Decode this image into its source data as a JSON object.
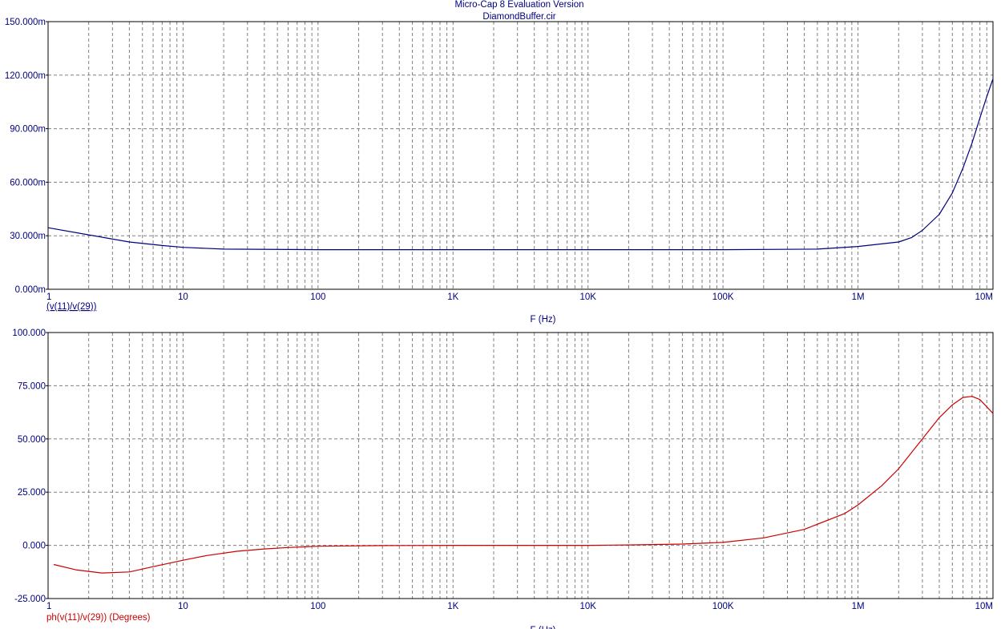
{
  "window": {
    "title": "Micro-Cap 8 Evaluation Version",
    "filename": "DiamondBuffer.cir"
  },
  "colors": {
    "text": "#000080",
    "grid": "#808080",
    "frame": "#000000",
    "magnitude_trace": "#000080",
    "phase_trace": "#cc0000",
    "background": "#ffffff"
  },
  "chart_data": [
    {
      "type": "line",
      "x_scale": "log",
      "xlim": [
        1,
        10000000
      ],
      "x_ticks": [
        1,
        10,
        100,
        1000,
        10000,
        100000,
        1000000,
        10000000
      ],
      "x_tick_labels": [
        "1",
        "10",
        "100",
        "1K",
        "10K",
        "100K",
        "1M",
        "10M"
      ],
      "xlabel": "F (Hz)",
      "ylim": [
        0,
        0.15
      ],
      "y_ticks": [
        0,
        0.03,
        0.06,
        0.09,
        0.12,
        0.15
      ],
      "y_tick_labels": [
        "0.000m",
        "30.000m",
        "60.000m",
        "90.000m",
        "120.000m",
        "150.000m"
      ],
      "grid": true,
      "legend_position": "bottom-left",
      "series": [
        {
          "name": "(v(11)/v(29))",
          "color": "#000080",
          "x": [
            1,
            2,
            4,
            7,
            10,
            20,
            100,
            1000,
            10000,
            100000,
            500000,
            1000000,
            2000000,
            2500000,
            3000000,
            4000000,
            5000000,
            6000000,
            7000000,
            8000000,
            9000000,
            10000000
          ],
          "y": [
            0.0345,
            0.0305,
            0.0265,
            0.0245,
            0.0235,
            0.0225,
            0.0222,
            0.0222,
            0.0222,
            0.0222,
            0.0225,
            0.024,
            0.0265,
            0.029,
            0.033,
            0.042,
            0.054,
            0.068,
            0.082,
            0.096,
            0.108,
            0.118
          ]
        }
      ]
    },
    {
      "type": "line",
      "x_scale": "log",
      "xlim": [
        1,
        10000000
      ],
      "x_ticks": [
        1,
        10,
        100,
        1000,
        10000,
        100000,
        1000000,
        10000000
      ],
      "x_tick_labels": [
        "1",
        "10",
        "100",
        "1K",
        "10K",
        "100K",
        "1M",
        "10M"
      ],
      "xlabel": "F (Hz)",
      "ylim": [
        -25,
        100
      ],
      "y_ticks": [
        -25,
        0,
        25,
        50,
        75,
        100
      ],
      "y_tick_labels": [
        "-25.000",
        "0.000",
        "25.000",
        "50.000",
        "75.000",
        "100.000"
      ],
      "grid": true,
      "legend_position": "bottom-left",
      "series": [
        {
          "name": "ph(v(11)/v(29)) (Degrees)",
          "color": "#cc0000",
          "x": [
            1.1,
            1.6,
            2.5,
            4,
            6,
            10,
            15,
            25,
            40,
            60,
            100,
            300,
            1000,
            10000,
            20000,
            50000,
            100000,
            200000,
            400000,
            800000,
            1000000,
            1500000,
            2000000,
            3000000,
            4000000,
            5000000,
            6000000,
            7000000,
            8000000,
            10000000
          ],
          "y": [
            -9,
            -11.5,
            -13,
            -12.5,
            -10,
            -7,
            -4.8,
            -2.8,
            -1.7,
            -1,
            -0.4,
            -0.1,
            0,
            0,
            0.2,
            0.6,
            1.4,
            3.5,
            7.5,
            15,
            19,
            28,
            36,
            50,
            60,
            66,
            69.5,
            70,
            68.5,
            62
          ]
        }
      ]
    }
  ]
}
